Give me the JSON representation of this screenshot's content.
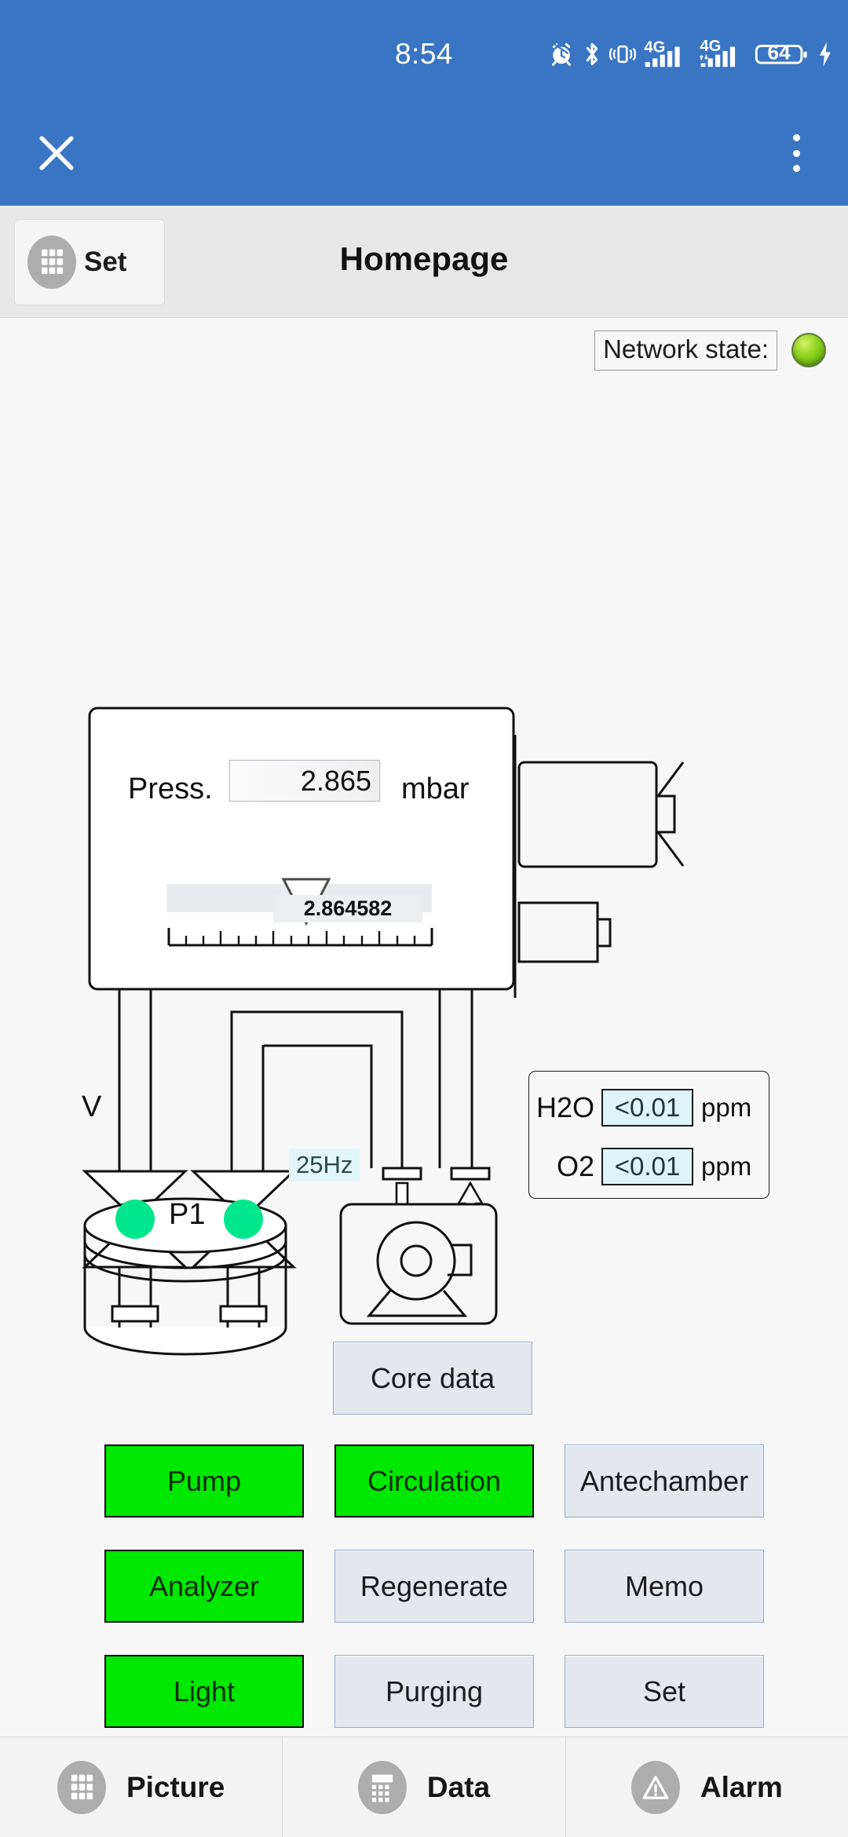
{
  "status_bar": {
    "clock": "8:54",
    "battery_level": "64",
    "network_label_1": "4G",
    "network_label_2": "4G",
    "icons": [
      "alarm-icon",
      "bluetooth-icon",
      "vibrate-icon",
      "signal-4g-icon",
      "signal-4g-data-icon",
      "battery-icon",
      "charging-bolt-icon"
    ]
  },
  "app_bar": {
    "close_icon": "close-icon",
    "overflow_icon": "overflow-menu-icon"
  },
  "sub_header": {
    "set_label": "Set",
    "set_icon": "grid-icon",
    "title": "Homepage"
  },
  "network": {
    "label": "Network state:",
    "led_state": "ok",
    "led_color": "#8fd41f"
  },
  "pressure_panel": {
    "label": "Press.",
    "value": "2.865",
    "unit": "mbar",
    "gauge_value": "2.864582"
  },
  "schematic": {
    "valve_label": "V",
    "tank_label": "P1",
    "frequency_label": "25Hz",
    "valve_led_color": "#00e68c",
    "valves": [
      {
        "name": "valve-left",
        "state": "open"
      },
      {
        "name": "valve-right",
        "state": "open"
      }
    ],
    "blower_icon": "centrifugal-blower-icon",
    "flow_down_icon": "arrow-down-icon",
    "flow_up_icon": "arrow-up-icon"
  },
  "gas_analyzer": {
    "rows": [
      {
        "name": "H2O",
        "value": "<0.01",
        "unit": "ppm"
      },
      {
        "name": "O2",
        "value": "<0.01",
        "unit": "ppm"
      }
    ]
  },
  "core_data_button": {
    "label": "Core data",
    "active": false
  },
  "control_buttons": [
    {
      "label": "Pump",
      "active": true
    },
    {
      "label": "Circulation",
      "active": true
    },
    {
      "label": "Antechamber",
      "active": false
    },
    {
      "label": "Analyzer",
      "active": true
    },
    {
      "label": "Regenerate",
      "active": false
    },
    {
      "label": "Memo",
      "active": false
    },
    {
      "label": "Light",
      "active": true
    },
    {
      "label": "Purging",
      "active": false
    },
    {
      "label": "Set",
      "active": false
    }
  ],
  "bottom_nav": [
    {
      "label": "Picture",
      "icon": "grid-icon"
    },
    {
      "label": "Data",
      "icon": "table-icon"
    },
    {
      "label": "Alarm",
      "icon": "warning-triangle-icon"
    }
  ],
  "colors": {
    "accent": "#3a75c4",
    "active_button": "#00e800",
    "idle_button": "#e3e8ef",
    "field_cyan": "#ddf5fa",
    "led_green": "#00e68c"
  }
}
